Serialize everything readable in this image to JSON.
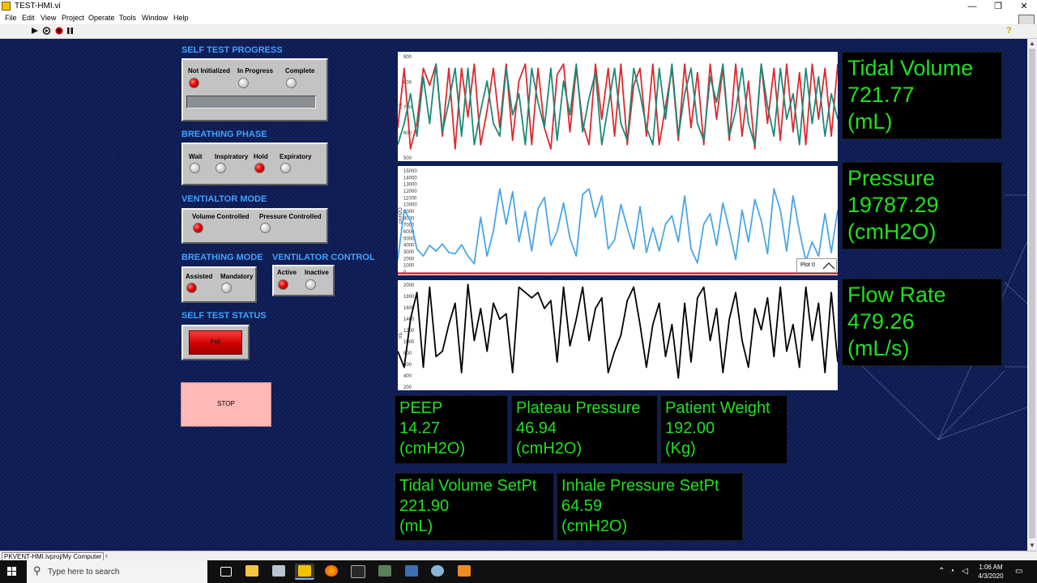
{
  "window": {
    "title": "TEST-HMI.vi",
    "minimize": "—",
    "maximize": "❐",
    "close": "✕"
  },
  "menu": [
    "File",
    "Edit",
    "View",
    "Project",
    "Operate",
    "Tools",
    "Window",
    "Help"
  ],
  "toolbar": {
    "run_icon": "run-arrow-icon",
    "run_continuous_icon": "run-continuously-icon",
    "abort_icon": "abort-icon",
    "pause_icon": "pause-icon",
    "help": "?"
  },
  "self_test_progress": {
    "title": "SELF TEST PROGRESS",
    "states": [
      {
        "label": "Not Initialized",
        "on": true
      },
      {
        "label": "In Progress",
        "on": false
      },
      {
        "label": "Complete",
        "on": false
      }
    ],
    "progress_value": 0
  },
  "breathing_phase": {
    "title": "BREATHING PHASE",
    "states": [
      {
        "label": "Wait",
        "on": false
      },
      {
        "label": "Inspiratory",
        "on": false
      },
      {
        "label": "Hold",
        "on": true
      },
      {
        "label": "Expiratory",
        "on": false
      }
    ]
  },
  "ventilator_mode": {
    "title": "VENTIALTOR MODE",
    "states": [
      {
        "label": "Volume Controlled",
        "on": true
      },
      {
        "label": "Pressure Controlled",
        "on": false
      }
    ]
  },
  "breathing_mode": {
    "title": "BREATHING MODE",
    "states": [
      {
        "label": "Assisted",
        "on": true
      },
      {
        "label": "Mandatory",
        "on": false
      }
    ]
  },
  "ventilator_control": {
    "title": "VENTILATOR CONTROL",
    "states": [
      {
        "label": "Active",
        "on": true
      },
      {
        "label": "Inactive",
        "on": false
      }
    ]
  },
  "self_test_status": {
    "title": "SELF TEST STATUS",
    "value": "Fail",
    "color": "#e00000"
  },
  "stop_button": {
    "label": "STOP"
  },
  "readouts": {
    "tidal_volume": {
      "name": "Tidal Volume",
      "value": "721.77",
      "unit": "(mL)"
    },
    "pressure": {
      "name": "Pressure",
      "value": "19787.29",
      "unit": "(cmH2O)"
    },
    "flow_rate": {
      "name": "Flow Rate",
      "value": "479.26",
      "unit": "(mL/s)"
    },
    "peep": {
      "name": "PEEP",
      "value": "14.27",
      "unit": "(cmH2O)"
    },
    "plateau_pressure": {
      "name": "Plateau Pressure",
      "value": "46.94",
      "unit": "(cmH2O)"
    },
    "patient_weight": {
      "name": "Patient Weight",
      "value": "192.00",
      "unit": "(Kg)"
    },
    "tidal_volume_setpt": {
      "name": "Tidal Volume SetPt",
      "value": "221.90",
      "unit": "(mL)"
    },
    "inhale_pressure_setpt": {
      "name": "Inhale Pressure SetPt",
      "value": "64.59",
      "unit": "(cmH2O)"
    }
  },
  "legend": {
    "label": "Plot 0"
  },
  "status_bar": {
    "path": "PKVENT-HMI.lvproj/My Computer"
  },
  "taskbar": {
    "search_placeholder": "Type here to search",
    "time": "1:06 AM",
    "date": "4/3/2020",
    "icons": [
      "task-view-icon",
      "file-explorer-icon",
      "app-icon",
      "labview-icon",
      "firefox-icon",
      "terminal-icon",
      "app-icon",
      "network-app-icon",
      "app-icon",
      "app-icon"
    ]
  },
  "colors": {
    "panel_bg": "#0c1a52",
    "section_header": "#3fa2ff",
    "readout_text": "#20e020",
    "led_on": "#e60000",
    "trace_red": "#e0282c",
    "trace_teal": "#1a8a78",
    "trace_blue": "#4aa6e8",
    "trace_black": "#000000"
  },
  "chart_data": [
    {
      "type": "line",
      "ylabel": "mL",
      "yticks": [
        "900",
        "800",
        "700",
        "600",
        "500"
      ],
      "ylim": [
        450,
        950
      ],
      "series": [
        {
          "color": "#e0282c",
          "values": [
            600,
            880,
            500,
            620,
            880,
            800,
            900,
            560,
            880,
            500,
            880,
            650,
            900,
            520,
            680,
            880,
            600,
            900,
            540,
            820,
            900,
            520,
            880,
            600,
            500,
            850,
            900,
            580,
            880,
            620,
            520,
            900,
            640,
            880,
            560,
            900,
            520,
            800,
            880,
            560,
            900,
            520,
            700,
            880,
            540,
            900,
            600,
            860,
            520,
            900,
            640,
            880,
            540,
            900,
            560,
            820,
            500,
            900,
            620,
            880,
            540,
            900,
            580,
            860,
            520,
            900,
            640,
            880,
            560,
            900
          ]
        },
        {
          "color": "#1a8a78",
          "values": [
            520,
            620,
            760,
            560,
            840,
            620,
            900,
            580,
            720,
            880,
            560,
            880,
            520,
            680,
            820,
            620,
            560,
            880,
            660,
            760,
            520,
            880,
            720,
            600,
            880,
            540,
            820,
            660,
            900,
            580,
            740,
            860,
            520,
            700,
            880,
            620,
            540,
            880,
            760,
            600,
            520,
            880,
            640,
            900,
            560,
            760,
            880,
            620,
            540,
            840,
            720,
            900,
            560,
            680,
            880,
            620,
            520,
            900,
            700,
            560,
            880,
            640,
            760,
            520,
            880,
            620,
            840,
            560,
            760,
            640
          ]
        }
      ]
    },
    {
      "type": "line",
      "ylabel": "cmH2O",
      "yticks": [
        "15000",
        "14000",
        "13000",
        "12000",
        "11000",
        "10000",
        "9000",
        "8000",
        "7000",
        "6000",
        "5000",
        "4000",
        "3000",
        "2000",
        "1000",
        "0"
      ],
      "ylim": [
        0,
        15000
      ],
      "series": [
        {
          "color": "#4aa6e8",
          "values": [
            2000,
            9000,
            7500,
            3500,
            2500,
            4000,
            3200,
            4200,
            3000,
            2800,
            4100,
            2500,
            1400,
            8000,
            2500,
            6000,
            12000,
            7000,
            11600,
            4500,
            8800,
            3200,
            9200,
            10800,
            4000,
            6000,
            10000,
            5000,
            2500,
            11200,
            12000,
            8000,
            11000,
            3500,
            4800,
            9800,
            6500,
            3500,
            9500,
            3000,
            6500,
            3200,
            7000,
            8200,
            4500,
            11000,
            3500,
            1500,
            7000,
            8500,
            4000,
            10000,
            6200,
            2000,
            9000,
            4500,
            10500,
            7500,
            2800,
            12000,
            9000,
            3200,
            11000,
            6000,
            1800,
            4500,
            2500,
            8500,
            3000,
            9000
          ]
        },
        {
          "color": "#e0282c",
          "values": [
            50,
            50,
            50,
            50,
            50,
            50,
            50,
            50,
            50,
            50
          ]
        }
      ]
    },
    {
      "type": "line",
      "ylabel": "mL",
      "yticks": [
        "2000",
        "1800",
        "1600",
        "1400",
        "1200",
        "1000",
        "800",
        "600",
        "400",
        "200"
      ],
      "ylim": [
        0,
        2000
      ],
      "series": [
        {
          "color": "#000000",
          "values": [
            700,
            400,
            1300,
            1800,
            400,
            1900,
            600,
            700,
            1200,
            1600,
            300,
            1950,
            900,
            1500,
            700,
            1600,
            1300,
            1400,
            300,
            1900,
            1800,
            1700,
            1800,
            1500,
            1650,
            500,
            1900,
            800,
            1300,
            1900,
            900,
            1500,
            1700,
            300,
            700,
            1000,
            1650,
            1900,
            1200,
            400,
            1200,
            1600,
            600,
            1200,
            200,
            1600,
            500,
            1700,
            1900,
            900,
            1500,
            300,
            1300,
            1800,
            900,
            400,
            1500,
            1100,
            1700,
            600,
            1900,
            700,
            1200,
            400,
            1900,
            900,
            1600,
            300,
            1800,
            500
          ]
        }
      ]
    }
  ]
}
